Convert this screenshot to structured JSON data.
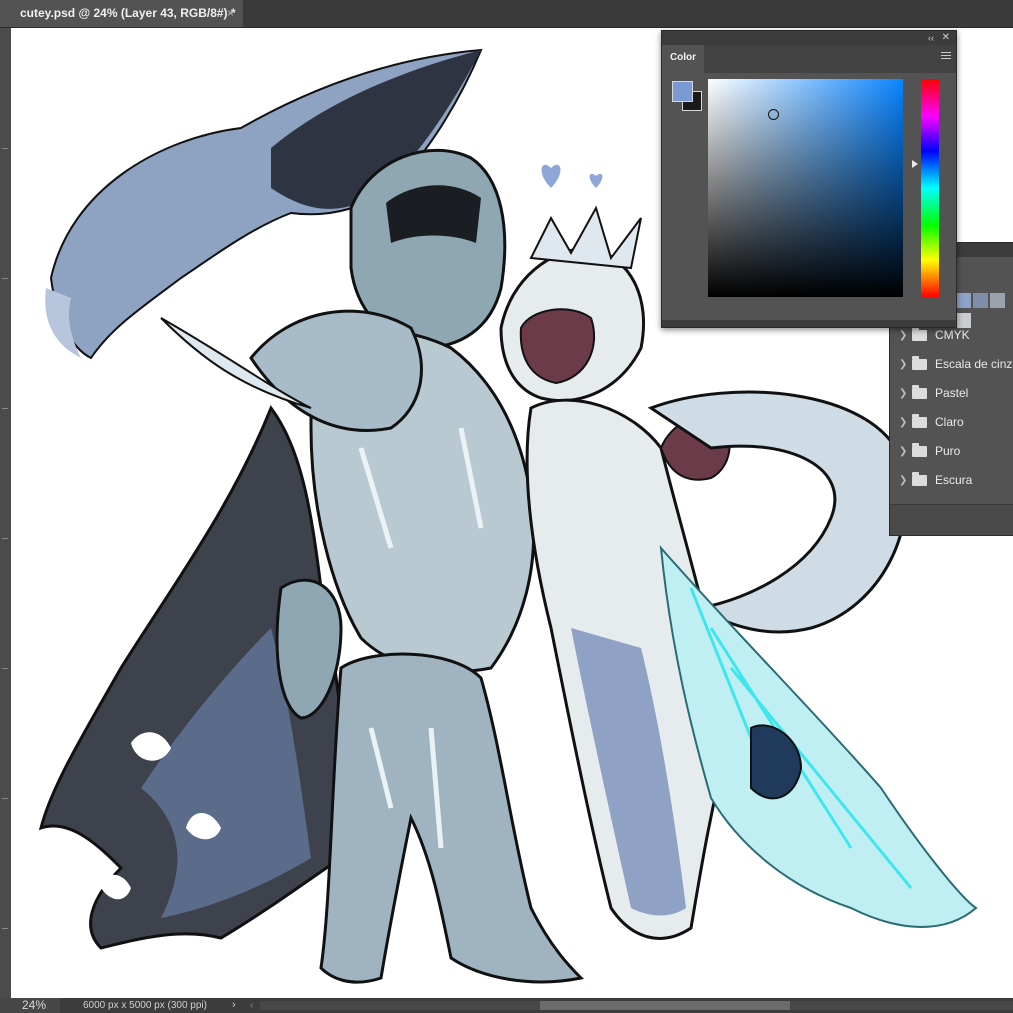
{
  "document": {
    "tab_title": "cutey.psd @ 24% (Layer 43, RGB/8#) *",
    "close_glyph": "×"
  },
  "color_panel": {
    "collapse_glyph": "‹‹",
    "close_glyph": "✕",
    "tab_label": "Color",
    "foreground_color": "#7b9ad3",
    "background_color": "#1a1a1a",
    "field_hue_color": "#0a84ff"
  },
  "swatches_panel": {
    "mini_swatches": [
      "#8fa3c7",
      "#7f8fa8",
      "#9aa3ad",
      "#c9ccd0"
    ],
    "folders": [
      {
        "label": "CMYK"
      },
      {
        "label": "Escala de cinza"
      },
      {
        "label": "Pastel"
      },
      {
        "label": "Claro"
      },
      {
        "label": "Puro"
      },
      {
        "label": "Escura"
      }
    ]
  },
  "status_bar": {
    "zoom": "24%",
    "doc_info": "6000 px x 5000 px (300 ppi)",
    "arrow_glyph": "›",
    "scroll_left_glyph": "‹"
  },
  "artwork": {
    "colors": {
      "cape_dark": "#1c1f26",
      "cape_mid": "#4a4e5a",
      "armor_light": "#c7d6df",
      "armor_mid": "#8fa6b3",
      "armor_dark": "#2e3338",
      "smoke": "#8ea2c2",
      "robe": "#e6ebee",
      "robe_shadow": "#8fa1c4",
      "wing": "#7fe0e6",
      "skin": "#6b3b4a",
      "heart": "#8ea7d8",
      "outline": "#111111"
    }
  }
}
